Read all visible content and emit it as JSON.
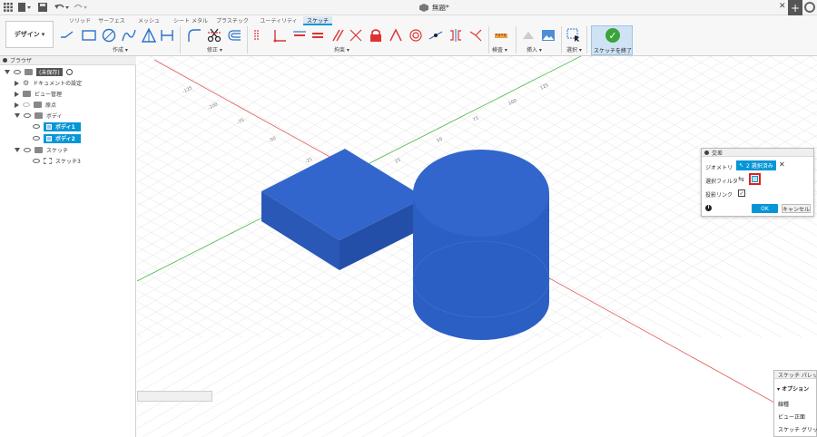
{
  "titlebar": {
    "doc_title": "無題*",
    "icons": [
      "app-grid-icon",
      "file-icon",
      "save-icon",
      "undo-icon",
      "redo-icon",
      "close-icon",
      "plus-icon",
      "profile-icon"
    ]
  },
  "toolbar": {
    "workspace": "デザイン",
    "tabs": [
      "ソリッド",
      "サーフェス",
      "メッシュ",
      "シート メタル",
      "プラスチック",
      "ユーティリティ",
      "スケッチ"
    ],
    "active_tab": "スケッチ",
    "groups": {
      "create": "作成",
      "modify": "修正",
      "constraints": "拘束",
      "inspect": "検査",
      "insert": "挿入",
      "select": "選択",
      "finish": "スケッチを終了"
    }
  },
  "browser": {
    "title": "ブラウザ",
    "root": "(未保存)",
    "items": {
      "doc_settings": "ドキュメントの設定",
      "named_views": "ビュー管理",
      "origin": "原点",
      "bodies": "ボディ",
      "body1": "ボディ1",
      "body2": "ボディ2",
      "sketches": "スケッチ",
      "sketch3": "スケッチ3"
    }
  },
  "canvas": {
    "axis_labels": {
      "a": "-125",
      "b": "-100",
      "c": "-75",
      "d": "-50",
      "e": "-25",
      "f": "25",
      "g": "50",
      "h": "75",
      "i": "100",
      "j": "125"
    },
    "colors": {
      "body": "#2b5fc4",
      "body_top": "#3366cc",
      "body_side": "#244fa8",
      "grid": "#e3e3e3",
      "axis_red": "#e05858",
      "axis_green": "#4cb84c"
    }
  },
  "dialog": {
    "title": "交差",
    "geometry_label": "ジオメトリ",
    "geometry_value": "2 選択済み",
    "filter_label": "選択フィルタ",
    "projection_label": "投影リンク",
    "ok": "OK",
    "cancel": "キャンセル",
    "info": "i"
  },
  "palette": {
    "title": "スケッチ パレット",
    "section": "オプション",
    "rows": [
      "線種",
      "ビュー正面",
      "スケッチ グリッド"
    ]
  }
}
